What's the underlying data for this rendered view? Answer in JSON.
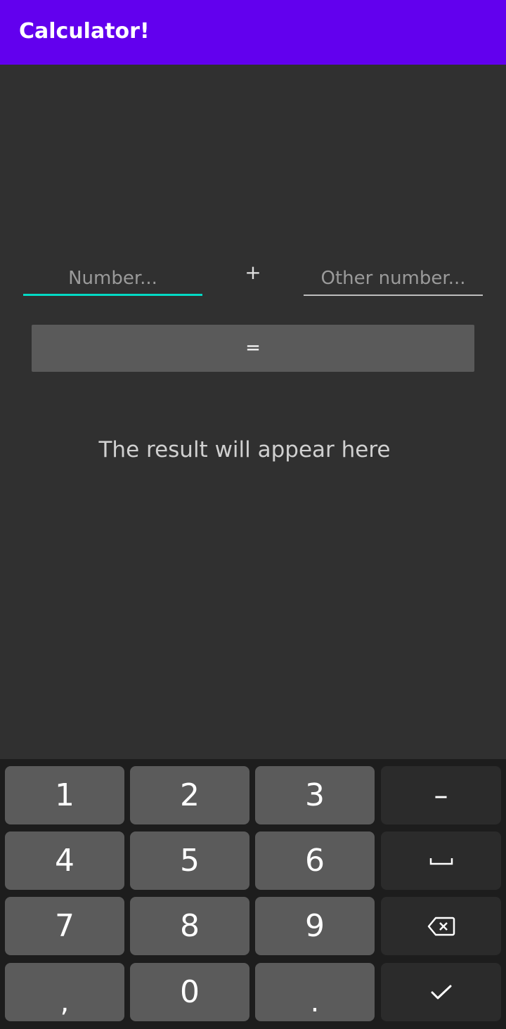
{
  "app_bar": {
    "title": "Calculator!",
    "color": "#6200EE"
  },
  "form": {
    "first_number": {
      "value": "",
      "placeholder": "Number..."
    },
    "operator_label": "+",
    "second_number": {
      "value": "",
      "placeholder": "Other number..."
    },
    "equals_button_label": "=",
    "result_text": "The result will appear here",
    "accent_color": "#03DAC5"
  },
  "keyboard": {
    "keys": {
      "k1": "1",
      "k2": "2",
      "k3": "3",
      "k4": "4",
      "k5": "5",
      "k6": "6",
      "k7": "7",
      "k8": "8",
      "k9": "9",
      "k0": "0",
      "comma": ",",
      "period": ".",
      "minus": "–"
    },
    "icons": {
      "space": "space-bar-icon",
      "backspace": "backspace-icon",
      "done": "checkmark-icon"
    }
  }
}
